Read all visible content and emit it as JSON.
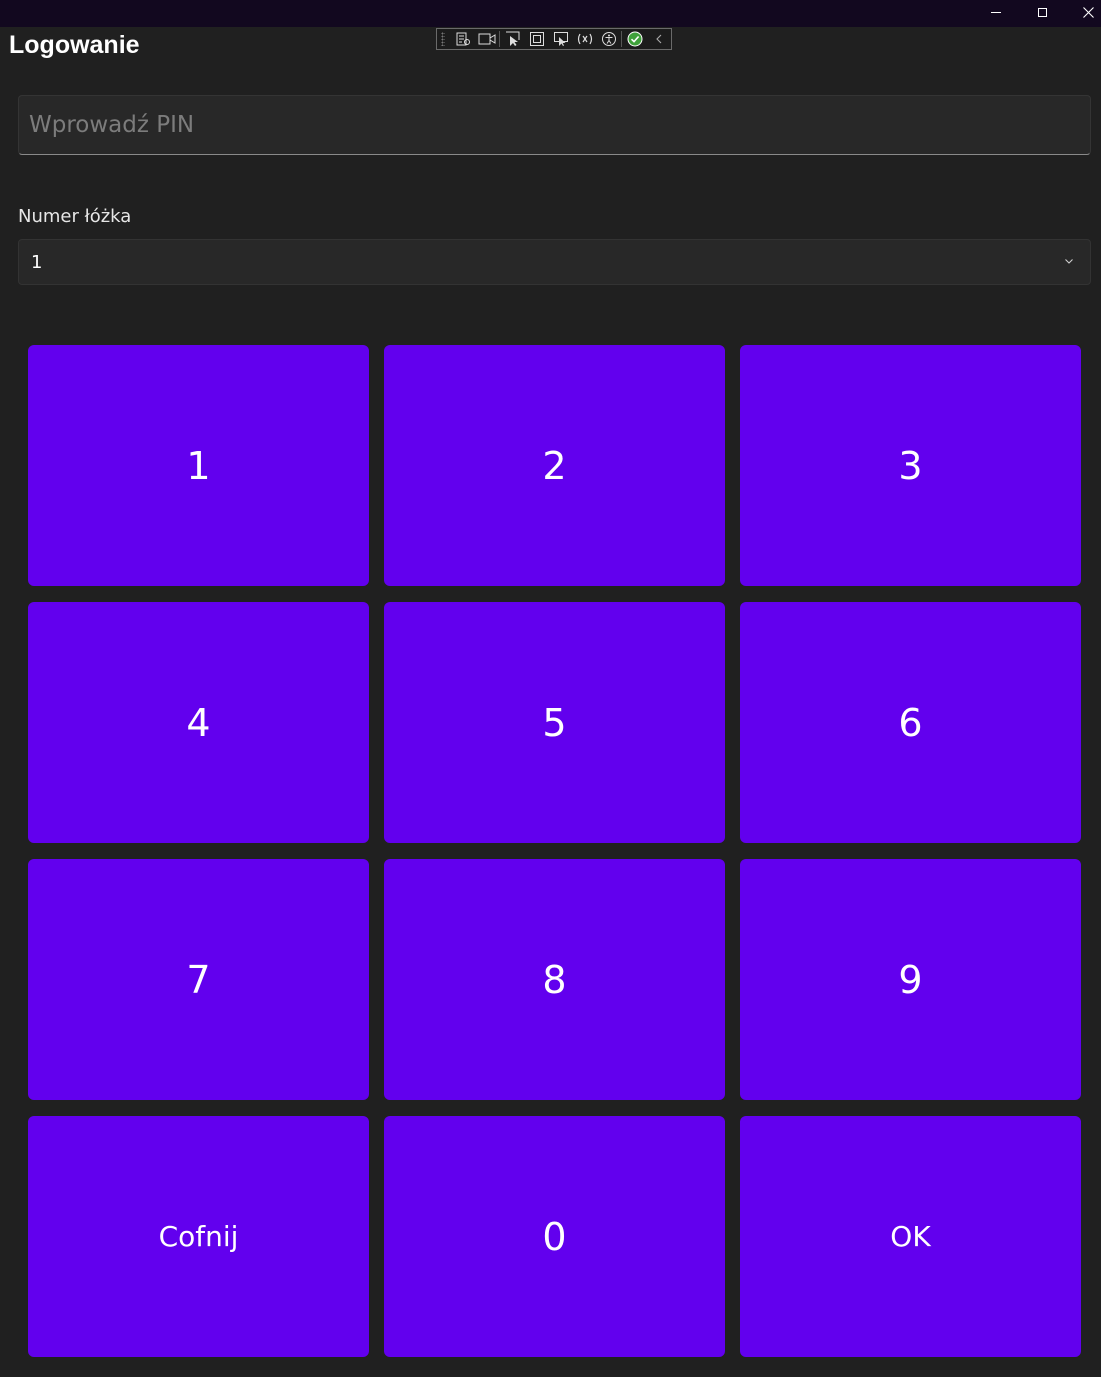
{
  "window": {
    "minimize_glyph": "",
    "controls": [
      "minimize-icon",
      "maximize-icon",
      "close-icon"
    ]
  },
  "debug_toolbar": {
    "icons": [
      "live-visual-tree-icon",
      "record-icon",
      "select-element-icon",
      "display-layout-adorners-icon",
      "track-focus-icon",
      "binding-failures-icon",
      "accessibility-icon",
      "check-status-icon",
      "collapse-chevron-icon"
    ]
  },
  "page": {
    "title": "Logowanie"
  },
  "pin": {
    "placeholder": "Wprowadź PIN",
    "value": ""
  },
  "bed": {
    "label": "Numer łóżka",
    "selected": "1"
  },
  "keypad": {
    "keys": [
      "1",
      "2",
      "3",
      "4",
      "5",
      "6",
      "7",
      "8",
      "9",
      "Cofnij",
      "0",
      "OK"
    ]
  },
  "colors": {
    "accent": "#6200ee",
    "background": "#202020",
    "titlebar": "#12081f"
  }
}
